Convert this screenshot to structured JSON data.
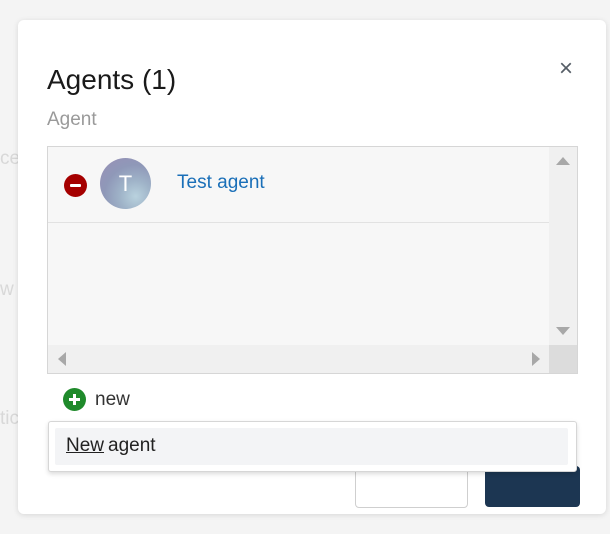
{
  "dialog": {
    "title": "Agents (1)",
    "close_symbol": "×",
    "field_label": "Agent",
    "agents": [
      {
        "avatar_letter": "T",
        "name": "Test agent"
      }
    ],
    "add_new_label": "new",
    "dropdown": {
      "item_underlined": "New",
      "item_rest": "agent"
    }
  },
  "colors": {
    "remove_icon": "#a50000",
    "add_icon": "#1f8a2b",
    "link": "#1a6fb8",
    "primary_button": "#1c3652"
  },
  "icons": {
    "remove": "minus-circle-icon",
    "add": "plus-circle-icon",
    "close": "close-icon"
  }
}
